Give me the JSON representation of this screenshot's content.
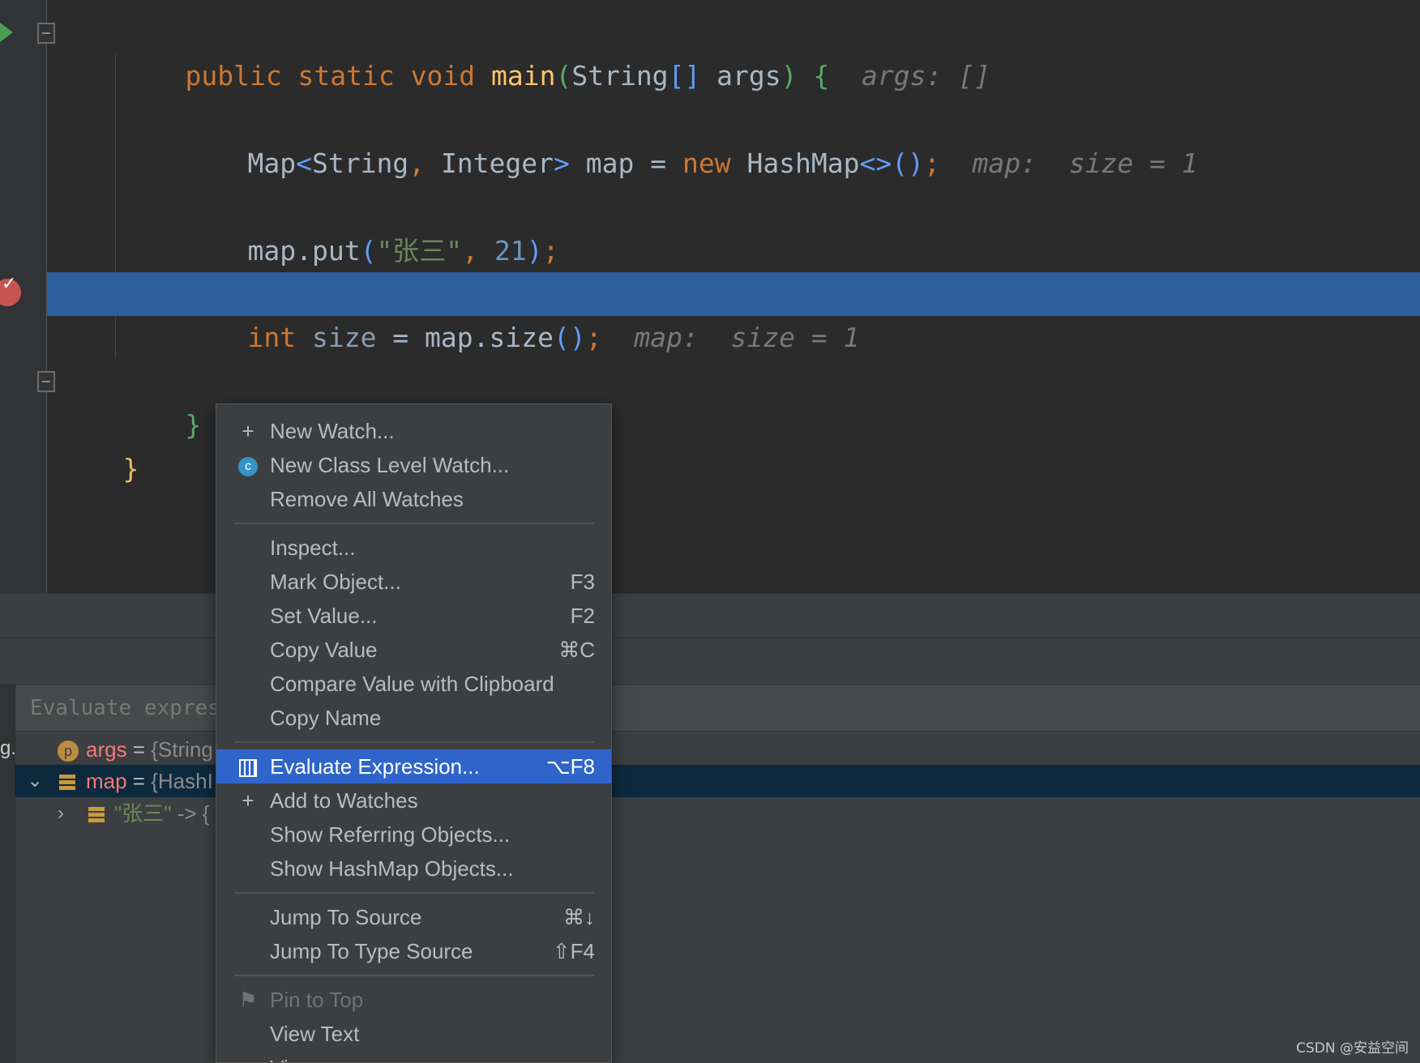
{
  "editor": {
    "line1": {
      "kw1": "public static void ",
      "fn": "main",
      "p1": "(",
      "type": "String",
      "arr": "[]",
      "args": " args",
      "p2": ")",
      "brace": " {",
      "hint": "  args: []"
    },
    "line2": {
      "a": "Map",
      "lt": "<",
      "t1": "String",
      "comma": ", ",
      "t2": "Integer",
      "gt": ">",
      "rest": " map = ",
      "kw": "new",
      "cls": " HashMap",
      "diamond": "<>",
      "call": "()",
      "semi": ";",
      "hint": "  map:  size = 1"
    },
    "line3": {
      "a": "map.put",
      "p": "(",
      "str": "\"张三\"",
      "comma": ", ",
      "num": "21",
      "p2": ")",
      "semi": ";"
    },
    "line4": {
      "kw": "int",
      "var": " size",
      "rest": " = map.size",
      "p": "()",
      "semi": ";",
      "hint": "  map:  size = 1"
    },
    "line5": {
      "brace": "}"
    },
    "line6": {
      "brace": "}"
    }
  },
  "debugger": {
    "eval_placeholder": "Evaluate expres",
    "side_label": "g.",
    "rows": [
      {
        "badge": "p",
        "name": "args",
        "eq": " = ",
        "value": "{String"
      },
      {
        "name": "map",
        "eq": " = ",
        "value": "{HashI"
      },
      {
        "key": "\"张三\"",
        "arrow": " -> {"
      }
    ]
  },
  "context_menu": {
    "items": [
      {
        "label": "New Watch...",
        "icon": "plus-icon",
        "shortcut": ""
      },
      {
        "label": "New Class Level Watch...",
        "icon": "class-watch-icon",
        "shortcut": ""
      },
      {
        "label": "Remove All Watches",
        "shortcut": ""
      },
      {
        "label": "Inspect...",
        "shortcut": ""
      },
      {
        "label": "Mark Object...",
        "shortcut": "F3"
      },
      {
        "label": "Set Value...",
        "shortcut": "F2"
      },
      {
        "label": "Copy Value",
        "shortcut": "⌘C"
      },
      {
        "label": "Compare Value with Clipboard",
        "shortcut": ""
      },
      {
        "label": "Copy Name",
        "shortcut": ""
      },
      {
        "label": "Evaluate Expression...",
        "icon": "calculator-icon",
        "shortcut": "⌥F8"
      },
      {
        "label": "Add to Watches",
        "icon": "add-watch-icon",
        "shortcut": ""
      },
      {
        "label": "Show Referring Objects...",
        "shortcut": ""
      },
      {
        "label": "Show HashMap Objects...",
        "shortcut": ""
      },
      {
        "label": "Jump To Source",
        "shortcut": "⌘↓"
      },
      {
        "label": "Jump To Type Source",
        "shortcut": "⇧F4"
      },
      {
        "label": "Pin to Top",
        "icon": "flag-icon",
        "shortcut": ""
      },
      {
        "label": "View Text",
        "shortcut": ""
      },
      {
        "label": "View as",
        "shortcut": ""
      }
    ]
  },
  "watermark": "CSDN @安益空间",
  "colors": {
    "selection": "#2f65ca",
    "highlight_line": "#2d5e9d",
    "keyword": "#cc7832",
    "string": "#6a8759",
    "number": "#6897bb"
  }
}
